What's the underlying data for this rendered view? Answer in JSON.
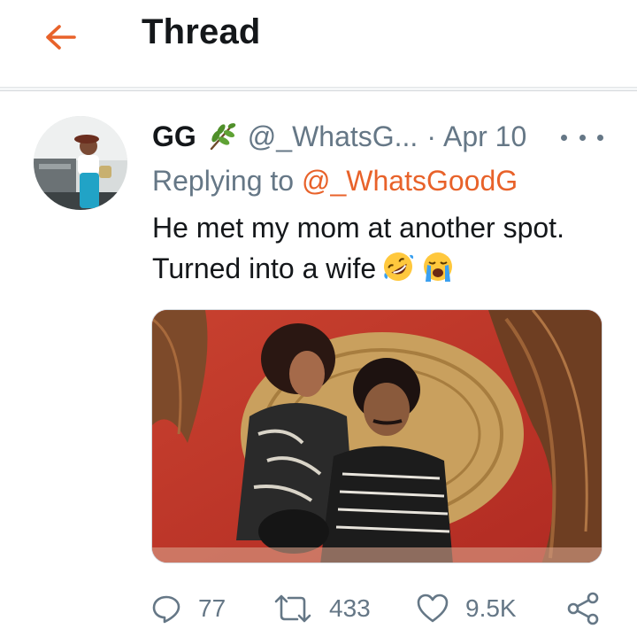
{
  "header": {
    "title": "Thread",
    "back_icon": "arrow-left-icon",
    "accent_color": "#e8622a"
  },
  "tweet": {
    "display_name": "GG",
    "name_emoji": "herb-icon",
    "handle": "@_WhatsG...",
    "separator": "·",
    "date": "Apr 10",
    "replying_prefix": "Replying to",
    "replying_handle": "@_WhatsGoodG",
    "text_line1": "He met my mom at another spot.",
    "text_line2": "Turned into a wife",
    "text_emojis": [
      "rolling-on-floor-laughing-icon",
      "loudly-crying-face-icon"
    ],
    "media_description_icon": "photo"
  },
  "actions": {
    "reply_count": "77",
    "retweet_count": "433",
    "like_count": "9.5K",
    "share_icon": "share-icon"
  },
  "colors": {
    "text": "#14171a",
    "muted": "#657786",
    "link": "#e8622a"
  }
}
